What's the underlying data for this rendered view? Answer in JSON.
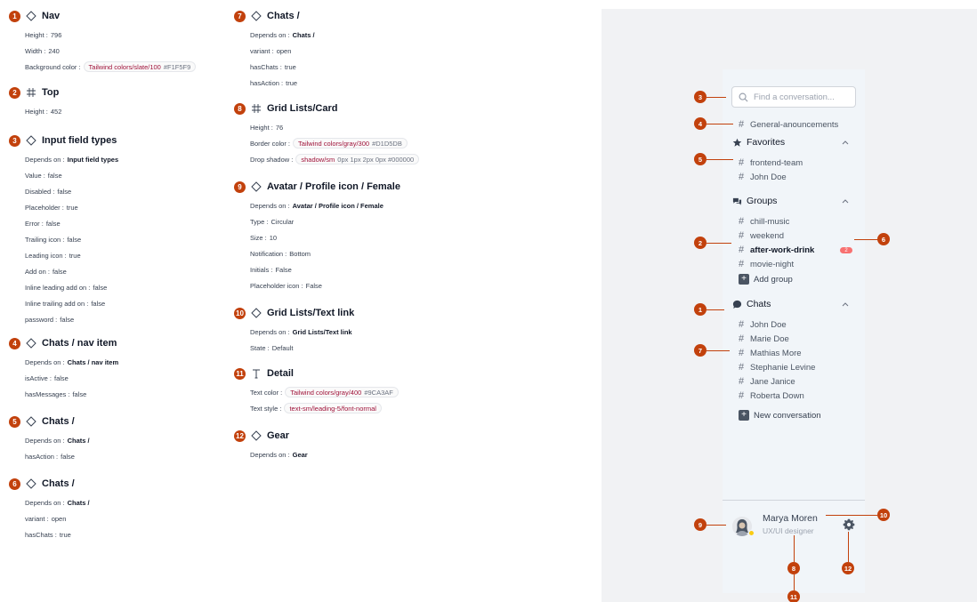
{
  "left_column": [
    {
      "num": "1",
      "icon": "diamond",
      "title": "Nav",
      "rows": [
        {
          "key": "Height : ",
          "value": "796"
        },
        {
          "key": "Width : ",
          "value": "240"
        },
        {
          "key": "Background color : ",
          "token_name": "Tailwind colors/slate/100",
          "token_value": "#F1F5F9"
        }
      ]
    },
    {
      "num": "2",
      "icon": "frame",
      "title": "Top",
      "rows": [
        {
          "key": "Height : ",
          "value": "452"
        }
      ]
    },
    {
      "num": "3",
      "icon": "diamond",
      "title": "Input field types",
      "rows": [
        {
          "key": "Depends on : ",
          "bold": "Input field types"
        },
        {
          "key": "Value : ",
          "value": "false"
        },
        {
          "key": "Disabled : ",
          "value": "false"
        },
        {
          "key": "Placeholder : ",
          "value": "true"
        },
        {
          "key": "Error : ",
          "value": "false"
        },
        {
          "key": "Trailing icon : ",
          "value": "false"
        },
        {
          "key": "Leading icon : ",
          "value": "true"
        },
        {
          "key": "Add on : ",
          "value": "false"
        },
        {
          "key": "Inline leading add on : ",
          "value": "false"
        },
        {
          "key": "Inline trailing add on : ",
          "value": "false"
        },
        {
          "key": "password : ",
          "value": "false"
        }
      ]
    },
    {
      "num": "4",
      "icon": "diamond",
      "title": "Chats / nav item",
      "rows": [
        {
          "key": "Depends on : ",
          "bold": "Chats / nav item"
        },
        {
          "key": "isActive : ",
          "value": "false"
        },
        {
          "key": "hasMessages : ",
          "value": "false"
        }
      ]
    },
    {
      "num": "5",
      "icon": "diamond",
      "title": "Chats /",
      "rows": [
        {
          "key": "Depends on : ",
          "bold": "Chats /"
        },
        {
          "key": "hasAction : ",
          "value": "false"
        }
      ]
    },
    {
      "num": "6",
      "icon": "diamond",
      "title": "Chats /",
      "rows": [
        {
          "key": "Depends on : ",
          "bold": "Chats /"
        },
        {
          "key": "variant : ",
          "value": "open"
        },
        {
          "key": "hasChats : ",
          "value": "true"
        }
      ]
    }
  ],
  "mid_column": [
    {
      "num": "7",
      "icon": "diamond",
      "title": "Chats /",
      "rows": [
        {
          "key": "Depends on : ",
          "bold": "Chats /"
        },
        {
          "key": "variant : ",
          "value": "open"
        },
        {
          "key": "hasChats : ",
          "value": "true"
        },
        {
          "key": "hasAction : ",
          "value": "true"
        }
      ]
    },
    {
      "num": "8",
      "icon": "frame",
      "title": "Grid Lists/Card",
      "rows": [
        {
          "key": "Height : ",
          "value": "76"
        },
        {
          "key": "Border color : ",
          "token_name": "Tailwind colors/gray/300",
          "token_value": "#D1D5DB"
        },
        {
          "key": "Drop shadow : ",
          "token_name": "shadow/sm",
          "token_value": "0px 1px 2px 0px #000000"
        }
      ]
    },
    {
      "num": "9",
      "icon": "diamond",
      "title": "Avatar / Profile icon / Female",
      "rows": [
        {
          "key": "Depends on : ",
          "bold": "Avatar / Profile icon / Female"
        },
        {
          "key": "Type : ",
          "value": "Circular"
        },
        {
          "key": "Size : ",
          "value": "10"
        },
        {
          "key": "Notification : ",
          "value": "Bottom"
        },
        {
          "key": "Initials : ",
          "value": "False"
        },
        {
          "key": "Placeholder icon : ",
          "value": "False"
        }
      ]
    },
    {
      "num": "10",
      "icon": "diamond",
      "title": "Grid Lists/Text link",
      "rows": [
        {
          "key": "Depends on : ",
          "bold": "Grid Lists/Text link"
        },
        {
          "key": "State : ",
          "value": "Default"
        }
      ]
    },
    {
      "num": "11",
      "icon": "text",
      "title": "Detail",
      "rows": [
        {
          "key": "Text color : ",
          "token_name": "Tailwind colors/gray/400",
          "token_value": "#9CA3AF"
        },
        {
          "key": "Text style : ",
          "token_name": "text-sm/leading-5/font-normal",
          "token_value": ""
        }
      ]
    },
    {
      "num": "12",
      "icon": "diamond",
      "title": "Gear",
      "rows": [
        {
          "key": "Depends on : ",
          "bold": "Gear"
        }
      ]
    }
  ],
  "preview": {
    "search_placeholder": "Find a conversation...",
    "general_channel": "General-anouncements",
    "favorites": {
      "title": "Favorites",
      "items": [
        "frontend-team",
        "John Doe"
      ]
    },
    "groups": {
      "title": "Groups",
      "items": [
        "chill-music",
        "weekend",
        "after-work-drink",
        "movie-night"
      ],
      "unread_count": "2",
      "add_label": "Add group"
    },
    "chats": {
      "title": "Chats",
      "items": [
        "John Doe",
        "Marie Doe",
        "Mathias More",
        "Stephanie Levine",
        "Jane Janice",
        "Roberta Down"
      ],
      "add_label": "New conversation"
    },
    "user": {
      "name": "Marya Moren",
      "role": "UX/UI designer"
    },
    "callouts": [
      "1",
      "2",
      "3",
      "4",
      "5",
      "6",
      "7",
      "8",
      "9",
      "10",
      "11",
      "12"
    ]
  },
  "colors": {
    "accent": "#c2410c",
    "nav_bg": "#F1F5F9",
    "unread": "#f87171",
    "status_dot": "#facc15"
  }
}
